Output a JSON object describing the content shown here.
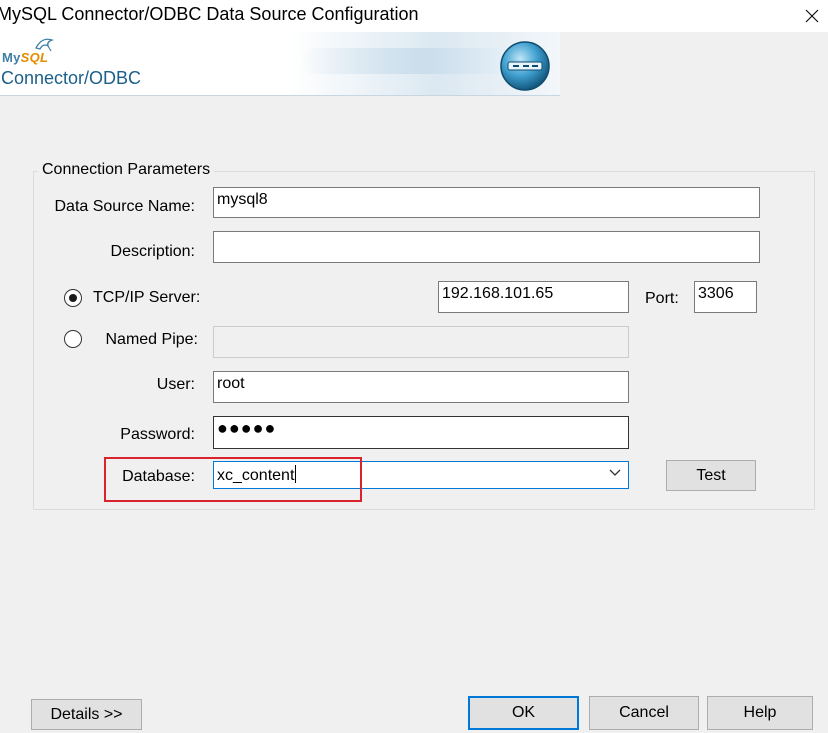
{
  "window": {
    "title": "MySQL Connector/ODBC Data Source Configuration"
  },
  "banner": {
    "brand_top_a": "My",
    "brand_top_b": "SQL",
    "brand_bottom": "Connector/ODBC"
  },
  "group": {
    "legend": "Connection Parameters"
  },
  "form": {
    "dsn_label": "Data Source Name:",
    "dsn_value": "mysql8",
    "description_label": "Description:",
    "description_value": "",
    "tcpip_label": "TCP/IP Server:",
    "tcpip_selected": true,
    "server_value": "192.168.101.65",
    "port_label": "Port:",
    "port_value": "3306",
    "named_pipe_label": "Named Pipe:",
    "named_pipe_value": "",
    "user_label": "User:",
    "user_value": "root",
    "password_label": "Password:",
    "password_masked": "●●●●●",
    "database_label": "Database:",
    "database_value": "xc_content",
    "test_button": "Test"
  },
  "buttons": {
    "details": "Details >>",
    "ok": "OK",
    "cancel": "Cancel",
    "help": "Help"
  },
  "icons": {
    "close": "close-icon",
    "dolphin": "mysql-dolphin-icon",
    "globe": "connector-globe-icon",
    "dropdown": "chevron-down-icon"
  },
  "colors": {
    "highlight": "#d9232d",
    "focus": "#0078d7",
    "brand_blue": "#1b5f8a",
    "brand_orange": "#e38c00"
  }
}
